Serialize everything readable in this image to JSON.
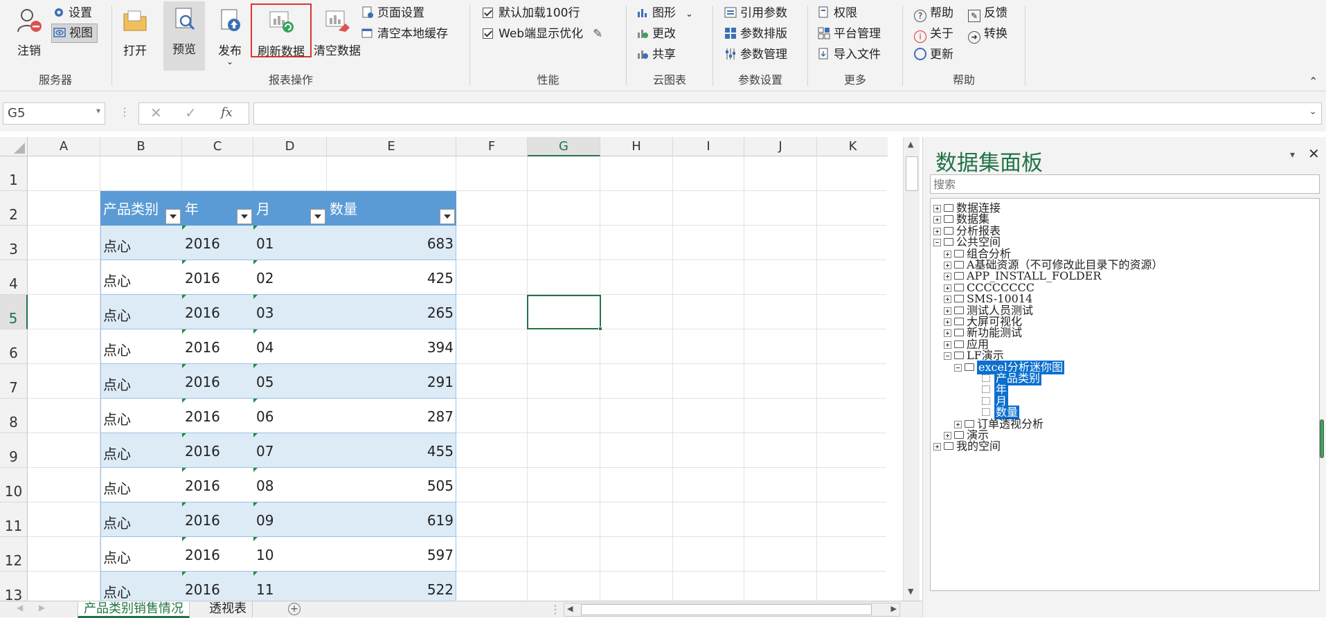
{
  "ribbon": {
    "server": {
      "logout": "注销",
      "settings": "设置",
      "view": "视图",
      "label": "服务器"
    },
    "report": {
      "open": "打开",
      "preview": "预览",
      "publish": "发布",
      "refresh": "刷新数据",
      "clear": "清空数据",
      "page_setup": "页面设置",
      "clear_cache": "清空本地缓存",
      "label": "报表操作"
    },
    "performance": {
      "load100": "默认加载100行",
      "web_opt": "Web端显示优化",
      "label": "性能"
    },
    "cloud": {
      "chart": "图形",
      "change": "更改",
      "share": "共享",
      "label": "云图表"
    },
    "params": {
      "ref": "引用参数",
      "layout": "参数排版",
      "manage": "参数管理",
      "label": "参数设置"
    },
    "more": {
      "perm": "权限",
      "platform": "平台管理",
      "import": "导入文件",
      "label": "更多"
    },
    "help": {
      "help": "帮助",
      "feedback": "反馈",
      "about": "关于",
      "convert": "转换",
      "update": "更新",
      "label": "帮助"
    }
  },
  "formula": {
    "cell_ref": "G5",
    "fx": "fx",
    "value": ""
  },
  "columns": [
    "A",
    "B",
    "C",
    "D",
    "E",
    "F",
    "G",
    "H",
    "I",
    "J",
    "K"
  ],
  "rows": [
    "1",
    "2",
    "3",
    "4",
    "5",
    "6",
    "7",
    "8",
    "9",
    "10",
    "11",
    "12",
    "13"
  ],
  "table": {
    "headers": [
      "产品类别",
      "年",
      "月",
      "数量"
    ],
    "rows": [
      [
        "点心",
        "2016",
        "01",
        "683"
      ],
      [
        "点心",
        "2016",
        "02",
        "425"
      ],
      [
        "点心",
        "2016",
        "03",
        "265"
      ],
      [
        "点心",
        "2016",
        "04",
        "394"
      ],
      [
        "点心",
        "2016",
        "05",
        "291"
      ],
      [
        "点心",
        "2016",
        "06",
        "287"
      ],
      [
        "点心",
        "2016",
        "07",
        "455"
      ],
      [
        "点心",
        "2016",
        "08",
        "505"
      ],
      [
        "点心",
        "2016",
        "09",
        "619"
      ],
      [
        "点心",
        "2016",
        "10",
        "597"
      ],
      [
        "点心",
        "2016",
        "11",
        "522"
      ]
    ]
  },
  "sheet_tabs": [
    "产品类别销售情况",
    "透视表"
  ],
  "panel": {
    "title": "数据集面板",
    "search_placeholder": "搜索",
    "tree": [
      "数据连接",
      "数据集",
      "分析报表",
      "公共空间",
      "组合分析",
      "A基础资源（不可修改此目录下的资源）",
      "APP_INSTALL_FOLDER",
      "CCCCCCCC",
      "SMS-10014",
      "测试人员测试",
      "大屏可视化",
      "新功能测试",
      "应用",
      "LF演示",
      "excel分析迷你图",
      "产品类别",
      "年",
      "月",
      "数量",
      "订单透视分析",
      "演示",
      "我的空间"
    ]
  }
}
